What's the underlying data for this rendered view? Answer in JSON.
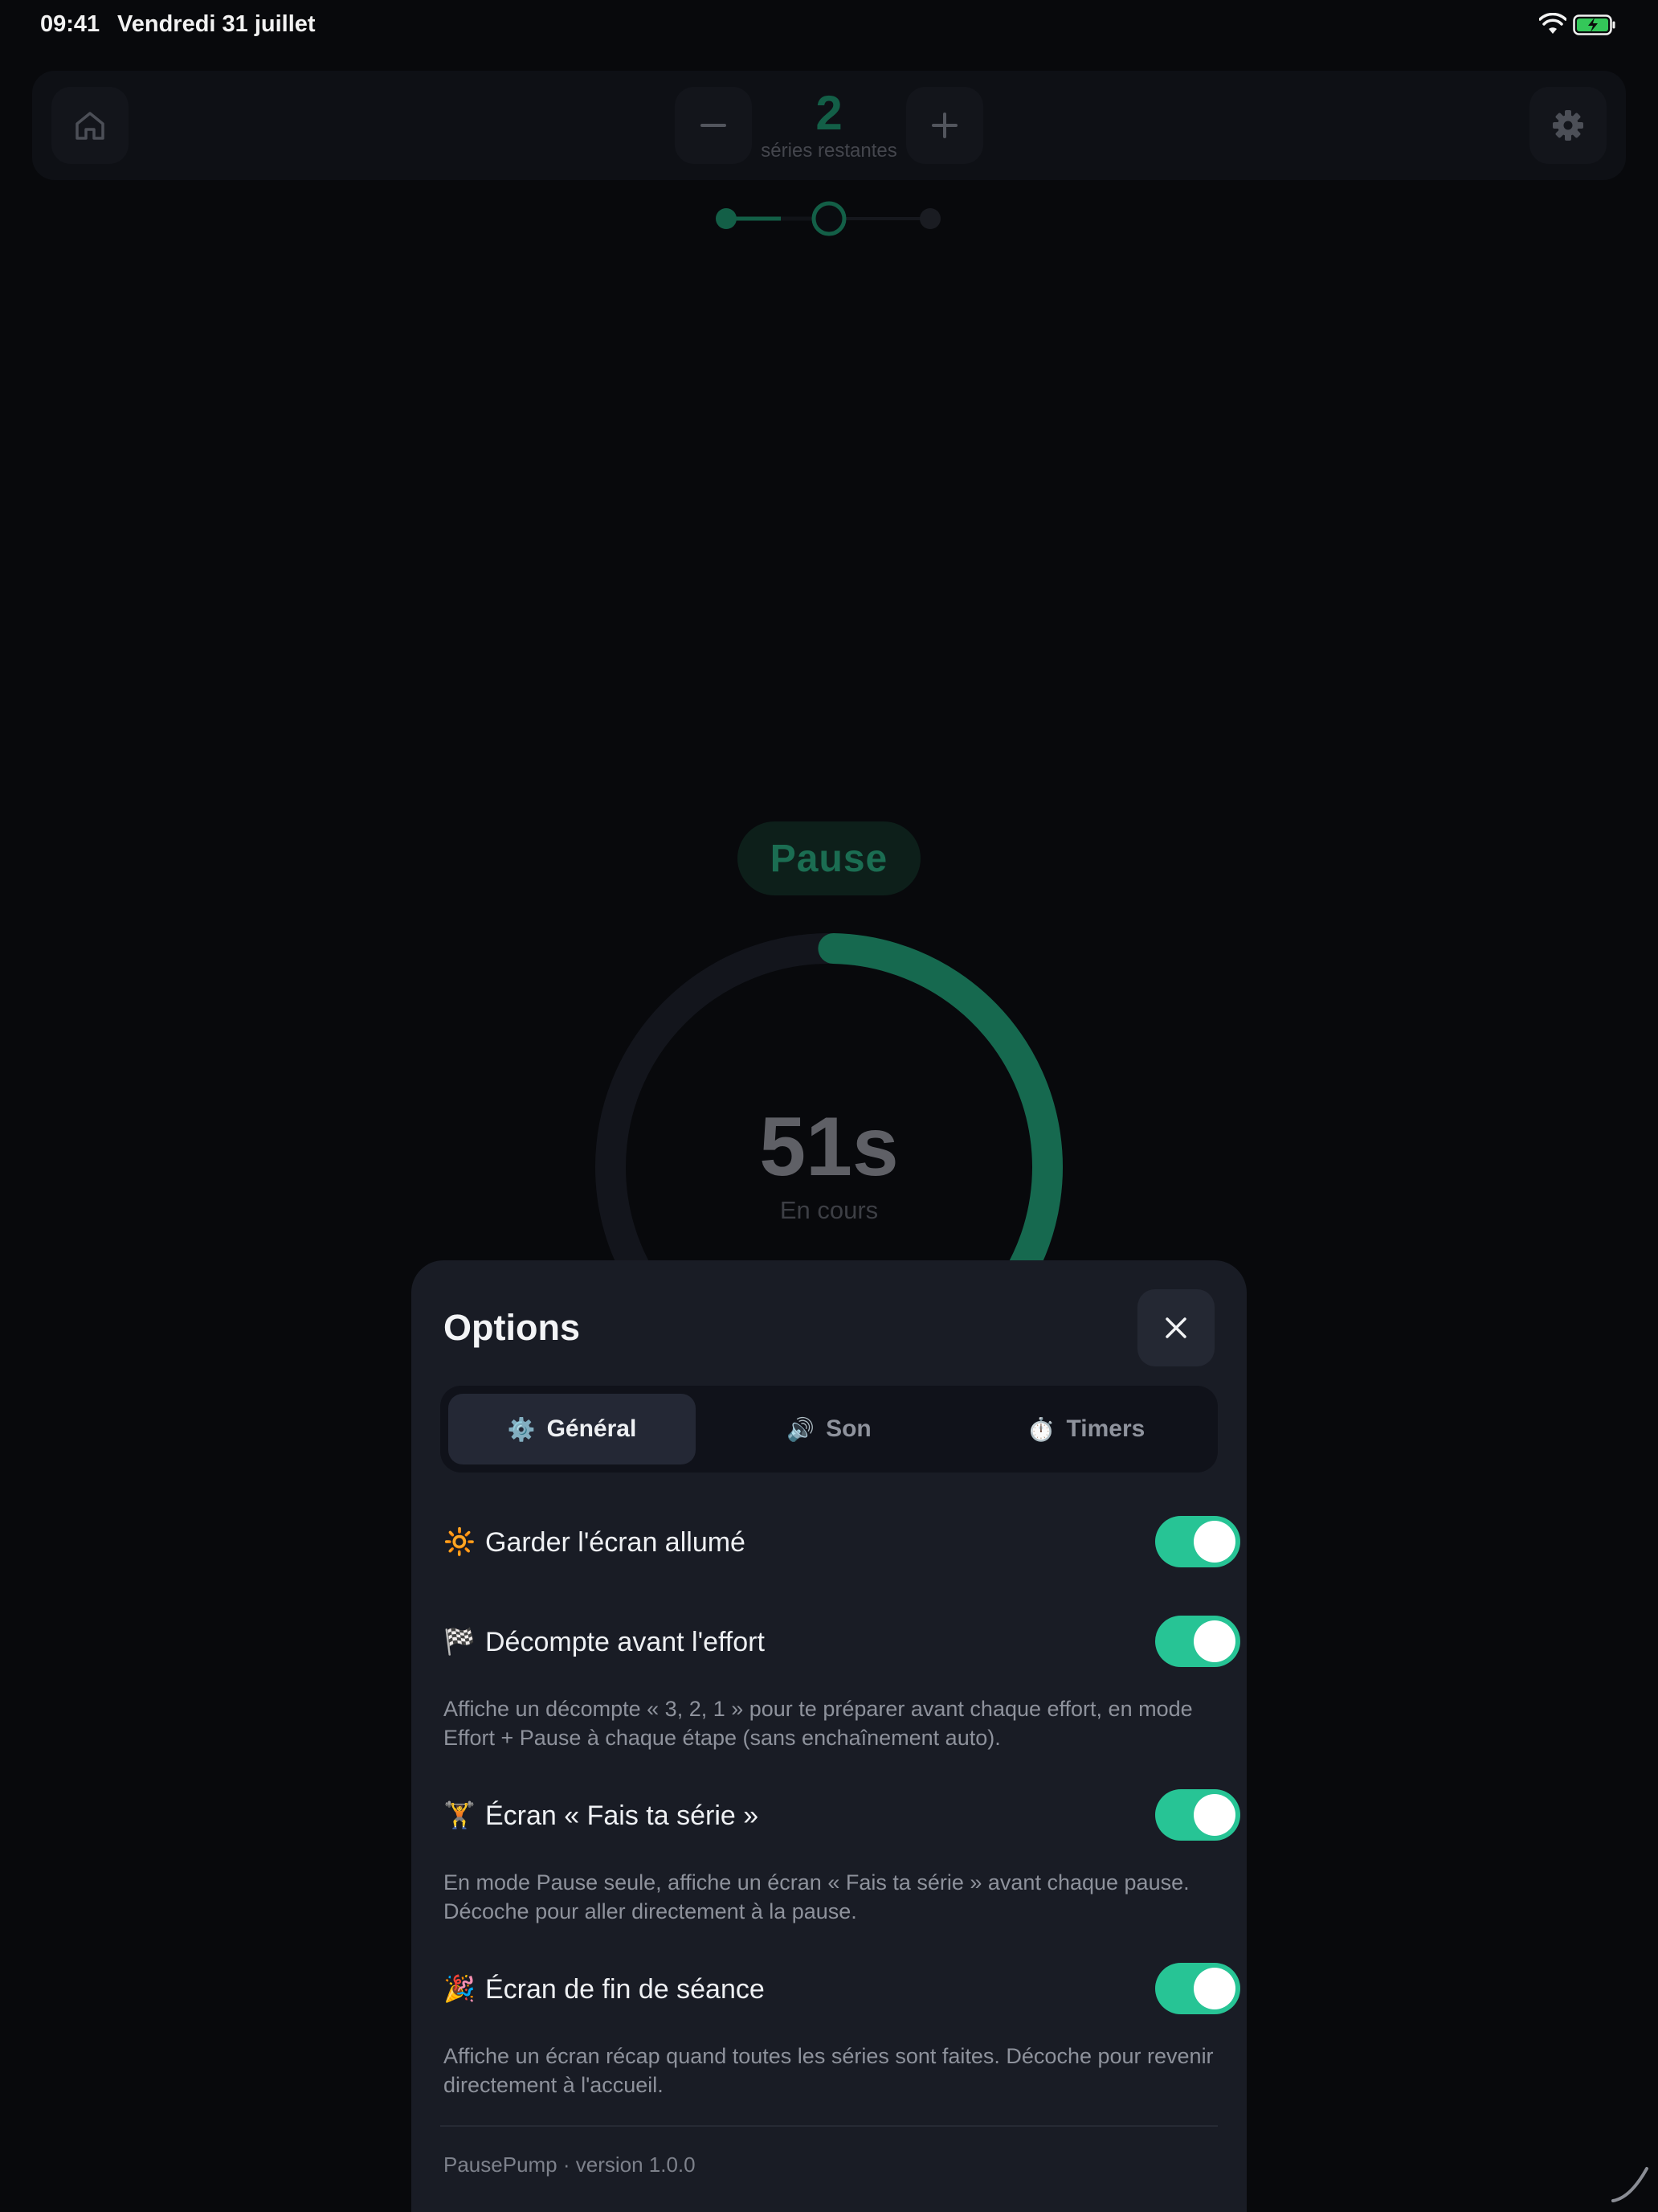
{
  "status_bar": {
    "time": "09:41",
    "date": "Vendredi 31 juillet",
    "wifi_icon": "wifi-icon",
    "battery_icon": "battery-charging-icon"
  },
  "top_bar": {
    "home_icon": "home-icon",
    "minus_icon": "minus-icon",
    "plus_icon": "plus-icon",
    "settings_icon": "gear-icon",
    "series_count": "2",
    "series_label": "séries restantes"
  },
  "progress_steps": {
    "total": 3,
    "current_step": 2
  },
  "timer": {
    "phase": "Pause",
    "value": "51s",
    "status": "En cours",
    "progress_fraction": 0.36
  },
  "modal": {
    "title": "Options",
    "close_icon": "close-icon",
    "tabs": [
      {
        "icon": "⚙️",
        "label": "Général",
        "active": true
      },
      {
        "icon": "🔊",
        "label": "Son",
        "active": false
      },
      {
        "icon": "⏱️",
        "label": "Timers",
        "active": false
      }
    ],
    "settings": [
      {
        "icon": "🔆",
        "label": "Garder l'écran allumé",
        "enabled": true,
        "description": ""
      },
      {
        "icon": "🏁",
        "label": "Décompte avant l'effort",
        "enabled": true,
        "description": "Affiche un décompte « 3, 2, 1 » pour te préparer avant chaque effort, en mode Effort + Pause à chaque étape (sans enchaînement auto)."
      },
      {
        "icon": "🏋️",
        "label": "Écran « Fais ta série »",
        "enabled": true,
        "description": "En mode Pause seule, affiche un écran « Fais ta série » avant chaque pause. Décoche pour aller directement à la pause."
      },
      {
        "icon": "🎉",
        "label": "Écran de fin de séance",
        "enabled": true,
        "description": "Affiche un écran récap quand toutes les séries sont faites. Décoche pour revenir directement à l'accueil."
      }
    ],
    "version": "PausePump · version 1.0.0"
  },
  "colors": {
    "accent": "#27c495",
    "accent_dim": "#16694f",
    "background": "#08090c",
    "modal_bg": "#191c25"
  }
}
